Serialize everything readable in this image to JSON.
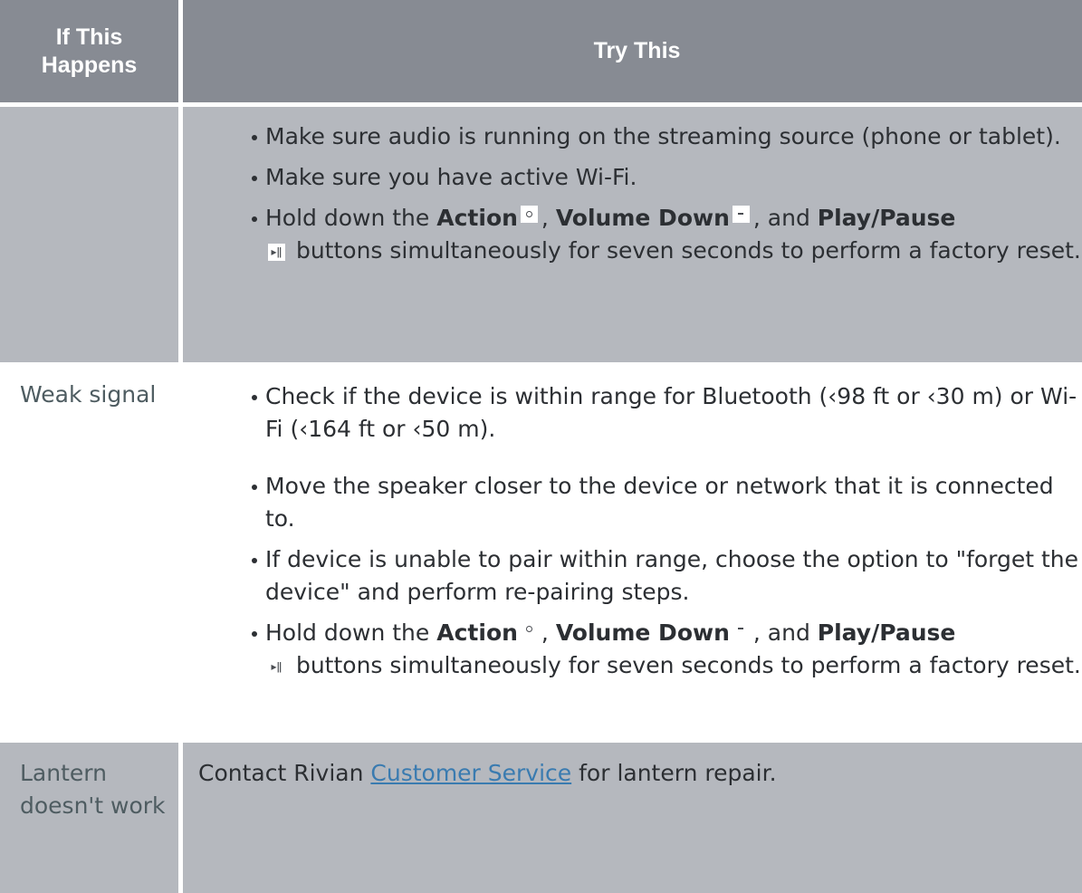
{
  "table": {
    "headers": {
      "col1": "If This Happens",
      "col2": "Try This"
    },
    "rows": [
      {
        "condition": "",
        "tips": [
          {
            "text": "Make sure audio is running on the streaming source (phone or tablet)."
          },
          {
            "text": "Make sure you have active Wi-Fi."
          },
          {
            "pre": "Hold down the",
            "action": "Action",
            "sep1": ",",
            "volume_down": "Volume Down",
            "sep2": ", and",
            "play_pause": "Play/Pause",
            "post": "buttons simultaneously for seven seconds to perform a factory reset."
          }
        ]
      },
      {
        "condition": "Weak signal",
        "tips": [
          {
            "text": "Check if the device is within range for Bluetooth (‹98 ft or ‹30 m) or Wi-Fi (‹164 ft or ‹50 m)."
          },
          {
            "text": "Move the speaker closer to the device or network that it is connected to."
          },
          {
            "text": "If device is unable to pair within range, choose the option to \"forget the device\" and perform re-pairing steps."
          },
          {
            "pre": "Hold down the",
            "action": "Action",
            "sep1": ",",
            "volume_down": "Volume Down",
            "sep2": ", and",
            "play_pause": "Play/Pause",
            "post": "buttons simultaneously for seven seconds to perform a factory reset."
          }
        ]
      },
      {
        "condition": "Lantern doesn't work",
        "contact": {
          "pre": "Contact Rivian",
          "link": "Customer Service",
          "post": "for lantern repair."
        }
      }
    ]
  },
  "icons": {
    "action": "action-button-icon",
    "volume_down": "volume-down-icon",
    "play_pause": "play-pause-icon",
    "play_pause_glyph": "▸ǁ"
  },
  "colors": {
    "header_bg": "#878b93",
    "shaded_row_bg": "#b5b8be",
    "link": "#3a7bb0"
  }
}
